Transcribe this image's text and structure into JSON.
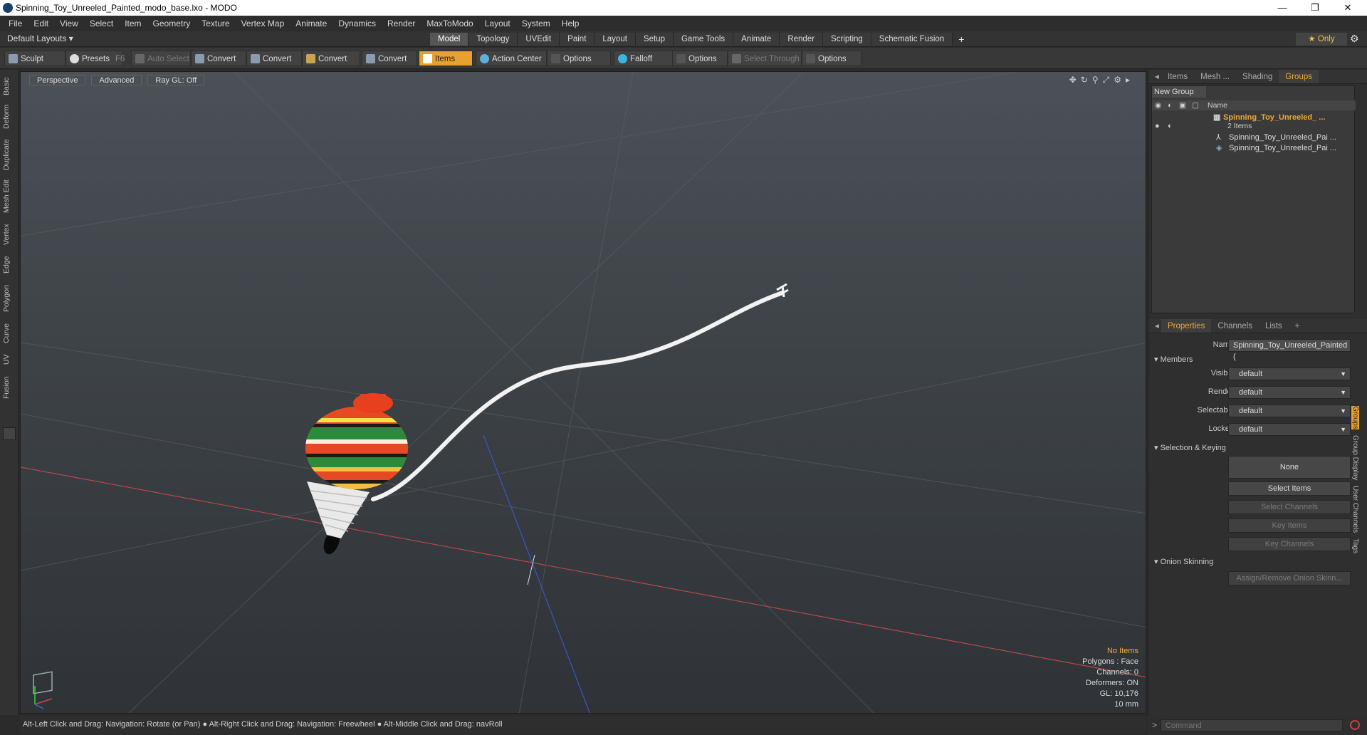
{
  "titlebar": {
    "title": "Spinning_Toy_Unreeled_Painted_modo_base.lxo - MODO",
    "minimize": "—",
    "maximize": "❐",
    "close": "✕"
  },
  "menu": [
    "File",
    "Edit",
    "View",
    "Select",
    "Item",
    "Geometry",
    "Texture",
    "Vertex Map",
    "Animate",
    "Dynamics",
    "Render",
    "MaxToModo",
    "Layout",
    "System",
    "Help"
  ],
  "layoutbar": {
    "layout_label": "Default Layouts ▾",
    "tabs": [
      "Model",
      "Topology",
      "UVEdit",
      "Paint",
      "Layout",
      "Setup",
      "Game Tools",
      "Animate",
      "Render",
      "Scripting",
      "Schematic Fusion"
    ],
    "active_tab": "Model",
    "plus": "+",
    "only_label": "★  Only"
  },
  "toolbar": {
    "sculpt": "Sculpt",
    "presets": "Presets",
    "presets_key": "F6",
    "auto_select": "Auto Select",
    "convert1": "Convert",
    "convert2": "Convert",
    "convert3": "Convert",
    "convert4": "Convert",
    "items": "Items",
    "action_center": "Action Center",
    "options1": "Options",
    "falloff": "Falloff",
    "options2": "Options",
    "select_through": "Select Through",
    "options3": "Options"
  },
  "left_tabs": [
    "Basic",
    "Deform",
    "Duplicate",
    "Mesh Edit",
    "Vertex",
    "Edge",
    "Polygon",
    "Curve",
    "UV",
    "Fusion"
  ],
  "viewport": {
    "perspective": "Perspective",
    "advanced": "Advanced",
    "raygl": "Ray GL: Off",
    "info": {
      "no_items": "No Items",
      "polygons": "Polygons : Face",
      "channels": "Channels: 0",
      "deformers": "Deformers: ON",
      "gl": "GL: 10,176",
      "scale": "10 mm"
    }
  },
  "statusbar": "Alt-Left Click and Drag: Navigation: Rotate (or Pan) ● Alt-Right Click and Drag: Navigation: Freewheel ● Alt-Middle Click and Drag: navRoll",
  "groups_panel": {
    "tabs": [
      "Items",
      "Mesh ...",
      "Shading",
      "Groups"
    ],
    "active_tab": "Groups",
    "new_group": "New Group",
    "name_col": "Name",
    "group_name": "Spinning_Toy_Unreeled_ ...",
    "group_count": "2 Items",
    "children": [
      "Spinning_Toy_Unreeled_Pai ...",
      "Spinning_Toy_Unreeled_Pai ..."
    ]
  },
  "properties": {
    "tabs": [
      "Properties",
      "Channels",
      "Lists",
      "+"
    ],
    "active_tab": "Properties",
    "name_label": "Name",
    "name_value": "Spinning_Toy_Unreeled_Painted (",
    "members": "Members",
    "visible_label": "Visible",
    "visible_value": "default",
    "render_label": "Render",
    "render_value": "default",
    "selectable_label": "Selectable",
    "selectable_value": "default",
    "locked_label": "Locked",
    "locked_value": "default",
    "selection_keying": "Selection & Keying",
    "none": "None",
    "select_items": "Select Items",
    "select_channels": "Select Channels",
    "key_items": "Key Items",
    "key_channels": "Key Channels",
    "onion_skinning": "Onion Skinning",
    "assign_onion": "Assign/Remove Onion Skinn..."
  },
  "right_vtabs": [
    "Groups",
    "Group Display",
    "User Channels",
    "Tags"
  ],
  "command_placeholder": "Command",
  "colors": {
    "accent": "#e8a12e",
    "viewport_top": "#4b5157",
    "viewport_bottom": "#2f3337"
  }
}
